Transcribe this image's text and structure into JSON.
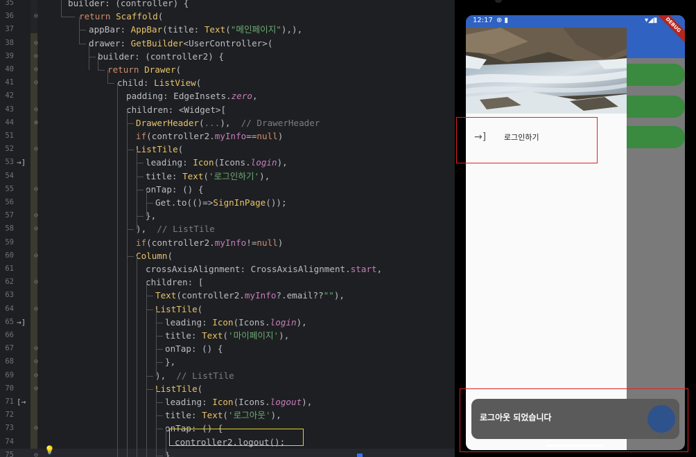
{
  "editor": {
    "lines": [
      {
        "num": "35",
        "fold": "",
        "icon": "",
        "html": "<span class=\"t\">builder: (controller) {</span>",
        "indent": 14
      },
      {
        "num": "36",
        "fold": "⊖",
        "icon": "",
        "html": "<span class=\"k\">return </span><span class=\"cls\">Scaffold</span><span class=\"t\">(</span>",
        "indent": 30
      },
      {
        "num": "37",
        "fold": "",
        "icon": "",
        "html": "<span class=\"t\">appBar: </span><span class=\"cls\">AppBar</span><span class=\"t\">(title: </span><span class=\"cls\">Text</span><span class=\"t\">(</span><span class=\"s\">\"메인페이지\"</span><span class=\"t\">),),</span>",
        "indent": 44
      },
      {
        "num": "38",
        "fold": "⊖",
        "icon": "",
        "html": "<span class=\"t\">drawer: </span><span class=\"cls\">GetBuilder</span><span class=\"t\">&lt;UserController&gt;(</span>",
        "indent": 44
      },
      {
        "num": "39",
        "fold": "⊖",
        "icon": "",
        "html": "<span class=\"t\">builder: (controller2) {</span>",
        "indent": 57
      },
      {
        "num": "40",
        "fold": "⊖",
        "icon": "",
        "html": "<span class=\"k\">return </span><span class=\"cls\">Drawer</span><span class=\"t\">(</span>",
        "indent": 71
      },
      {
        "num": "41",
        "fold": "⊖",
        "icon": "",
        "html": "<span class=\"t\">child: </span><span class=\"cls\">ListView</span><span class=\"t\">(</span>",
        "indent": 85
      },
      {
        "num": "42",
        "fold": "",
        "icon": "",
        "html": "<span class=\"t\">padding: EdgeInsets.</span><span class=\"p\"><i>zero</i></span><span class=\"t\">,</span>",
        "indent": 98
      },
      {
        "num": "43",
        "fold": "⊖",
        "icon": "",
        "html": "<span class=\"t\">children: &lt;Widget&gt;[</span>",
        "indent": 98
      },
      {
        "num": "44",
        "fold": "⊕",
        "icon": "",
        "html": "<span class=\"cls\">DrawerHeader</span><span class=\"t\">(</span><span class=\"c\">...</span><span class=\"t\">),  </span><span class=\"c\">// DrawerHeader</span>",
        "indent": 112
      },
      {
        "num": "51",
        "fold": "",
        "icon": "",
        "html": "<span class=\"k\">if</span><span class=\"t\">(controller2.</span><span class=\"p\">myInfo</span><span class=\"t\">==</span><span class=\"k\">null</span><span class=\"t\">)</span>",
        "indent": 112
      },
      {
        "num": "52",
        "fold": "⊖",
        "icon": "",
        "html": "<span class=\"cls\">ListTile</span><span class=\"t\">(</span>",
        "indent": 112
      },
      {
        "num": "53",
        "fold": "",
        "icon": "→]",
        "html": "<span class=\"t\">leading: </span><span class=\"cls\">Icon</span><span class=\"t\">(Icons.</span><span class=\"p\"><i>login</i></span><span class=\"t\">),</span>",
        "indent": 126
      },
      {
        "num": "54",
        "fold": "",
        "icon": "",
        "html": "<span class=\"t\">title: </span><span class=\"cls\">Text</span><span class=\"t\">(</span><span class=\"s\">'로그인하기'</span><span class=\"t\">),</span>",
        "indent": 126
      },
      {
        "num": "55",
        "fold": "⊖",
        "icon": "",
        "html": "<span class=\"t\">onTap: () {</span>",
        "indent": 126
      },
      {
        "num": "56",
        "fold": "",
        "icon": "",
        "html": "<span class=\"t\">Get.to(()=&gt;</span><span class=\"fnc\">SignInPage</span><span class=\"t\">());</span>",
        "indent": 140
      },
      {
        "num": "57",
        "fold": "⊖",
        "icon": "",
        "html": "<span class=\"t\">},</span>",
        "indent": 126
      },
      {
        "num": "58",
        "fold": "⊖",
        "icon": "",
        "html": "<span class=\"t\">),  </span><span class=\"c\">// ListTile</span>",
        "indent": 112
      },
      {
        "num": "59",
        "fold": "",
        "icon": "",
        "html": "<span class=\"k\">if</span><span class=\"t\">(controller2.</span><span class=\"p\">myInfo</span><span class=\"t\">!=</span><span class=\"k\">null</span><span class=\"t\">)</span>",
        "indent": 112
      },
      {
        "num": "60",
        "fold": "⊖",
        "icon": "",
        "html": "<span class=\"cls\">Column</span><span class=\"t\">(</span>",
        "indent": 112
      },
      {
        "num": "61",
        "fold": "",
        "icon": "",
        "html": "<span class=\"t\">crossAxisAlignment: CrossAxisAlignment.</span><span class=\"p\">start</span><span class=\"t\">,</span>",
        "indent": 126
      },
      {
        "num": "62",
        "fold": "⊖",
        "icon": "",
        "html": "<span class=\"t\">children: [</span>",
        "indent": 126
      },
      {
        "num": "63",
        "fold": "",
        "icon": "",
        "html": "<span class=\"cls\">Text</span><span class=\"t\">(controller2.</span><span class=\"p\">myInfo</span><span class=\"t\">?.email??</span><span class=\"s\">\"\"</span><span class=\"t\">),</span>",
        "indent": 140
      },
      {
        "num": "64",
        "fold": "⊖",
        "icon": "",
        "html": "<span class=\"cls\">ListTile</span><span class=\"t\">(</span>",
        "indent": 140
      },
      {
        "num": "65",
        "fold": "",
        "icon": "→]",
        "html": "<span class=\"t\">leading: </span><span class=\"cls\">Icon</span><span class=\"t\">(Icons.</span><span class=\"p\"><i>login</i></span><span class=\"t\">),</span>",
        "indent": 154
      },
      {
        "num": "66",
        "fold": "",
        "icon": "",
        "html": "<span class=\"t\">title: </span><span class=\"cls\">Text</span><span class=\"t\">(</span><span class=\"s\">'마이페이지'</span><span class=\"t\">),</span>",
        "indent": 154
      },
      {
        "num": "67",
        "fold": "⊖",
        "icon": "",
        "html": "<span class=\"t\">onTap: () {</span>",
        "indent": 154
      },
      {
        "num": "68",
        "fold": "⊖",
        "icon": "",
        "html": "<span class=\"t\">},</span>",
        "indent": 154
      },
      {
        "num": "69",
        "fold": "⊖",
        "icon": "",
        "html": "<span class=\"t\">),  </span><span class=\"c\">// ListTile</span>",
        "indent": 140
      },
      {
        "num": "70",
        "fold": "⊖",
        "icon": "",
        "html": "<span class=\"cls\">ListTile</span><span class=\"t\">(</span>",
        "indent": 140
      },
      {
        "num": "71",
        "fold": "",
        "icon": "[→",
        "html": "<span class=\"t\">leading: </span><span class=\"cls\">Icon</span><span class=\"t\">(Icons.</span><span class=\"p\"><i>logout</i></span><span class=\"t\">),</span>",
        "indent": 154
      },
      {
        "num": "72",
        "fold": "",
        "icon": "",
        "html": "<span class=\"t\">title: </span><span class=\"cls\">Text</span><span class=\"t\">(</span><span class=\"s\">'로그아웃'</span><span class=\"t\">),</span>",
        "indent": 154
      },
      {
        "num": "73",
        "fold": "⊖",
        "icon": "",
        "html": "<span class=\"t\">onTap: () {</span>",
        "indent": 154
      },
      {
        "num": "74",
        "fold": "",
        "icon": "",
        "html": "<span class=\"t\">controller2.logout();</span>",
        "indent": 168
      },
      {
        "num": "75",
        "fold": "⊖",
        "icon": "",
        "html": "<span class=\"t\">},</span>",
        "indent": 154
      }
    ]
  },
  "phone": {
    "status": {
      "time": "12:17",
      "left_icons": "⊕ ▮",
      "right_icons": "▾◢▮"
    },
    "debug_label": "DEBUG",
    "drawer_item": {
      "icon": "login-icon",
      "label": "로그인하기"
    },
    "snackbar": {
      "text": "로그아웃 되었습니다"
    }
  }
}
